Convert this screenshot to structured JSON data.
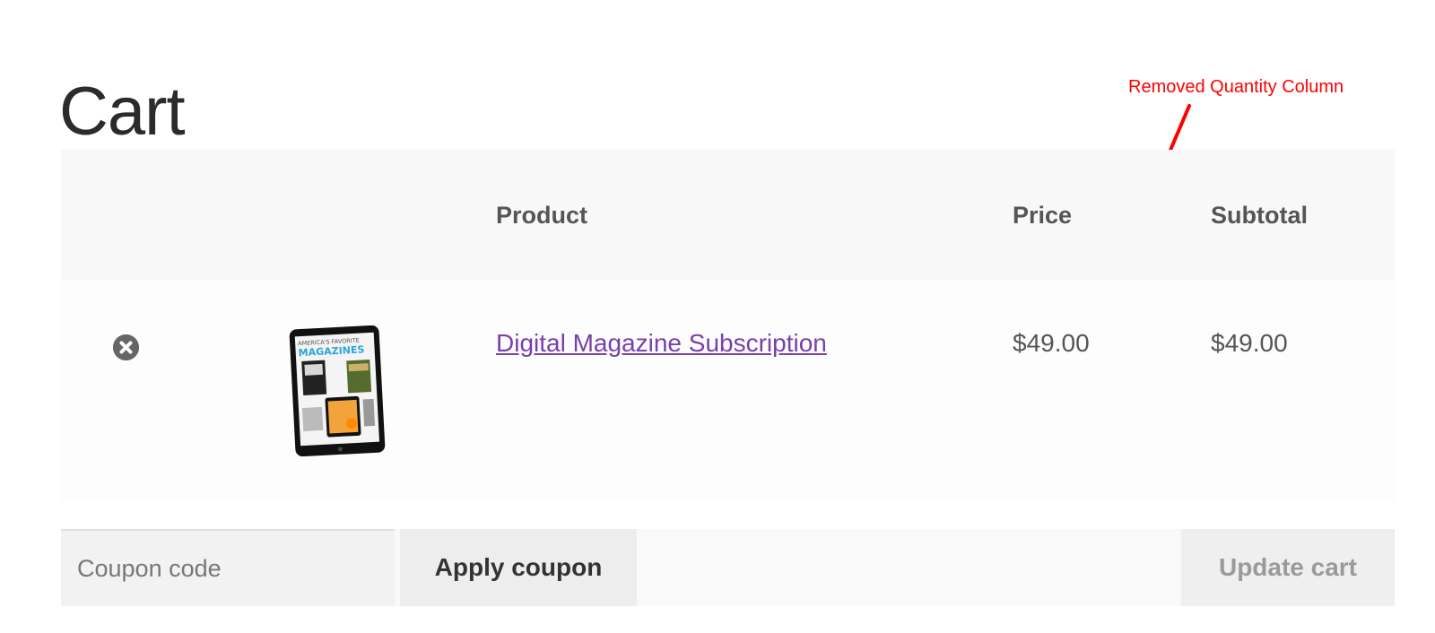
{
  "page": {
    "title": "Cart"
  },
  "annotation": {
    "text": "Removed Quantity Column",
    "color": "#ff0000"
  },
  "table": {
    "headers": {
      "product": "Product",
      "price": "Price",
      "subtotal": "Subtotal"
    },
    "rows": [
      {
        "remove_icon": "close-circle-icon",
        "thumbnail_text_line1": "AMERICA'S FAVORITE",
        "thumbnail_text_line2": "MAGAZINES",
        "product_name": "Digital Magazine Subscription",
        "price": "$49.00",
        "subtotal": "$49.00"
      }
    ]
  },
  "actions": {
    "coupon_placeholder": "Coupon code",
    "coupon_value": "",
    "apply_label": "Apply coupon",
    "update_label": "Update cart"
  },
  "colors": {
    "link": "#7a3fa8",
    "header_bg": "#f8f8f8"
  }
}
